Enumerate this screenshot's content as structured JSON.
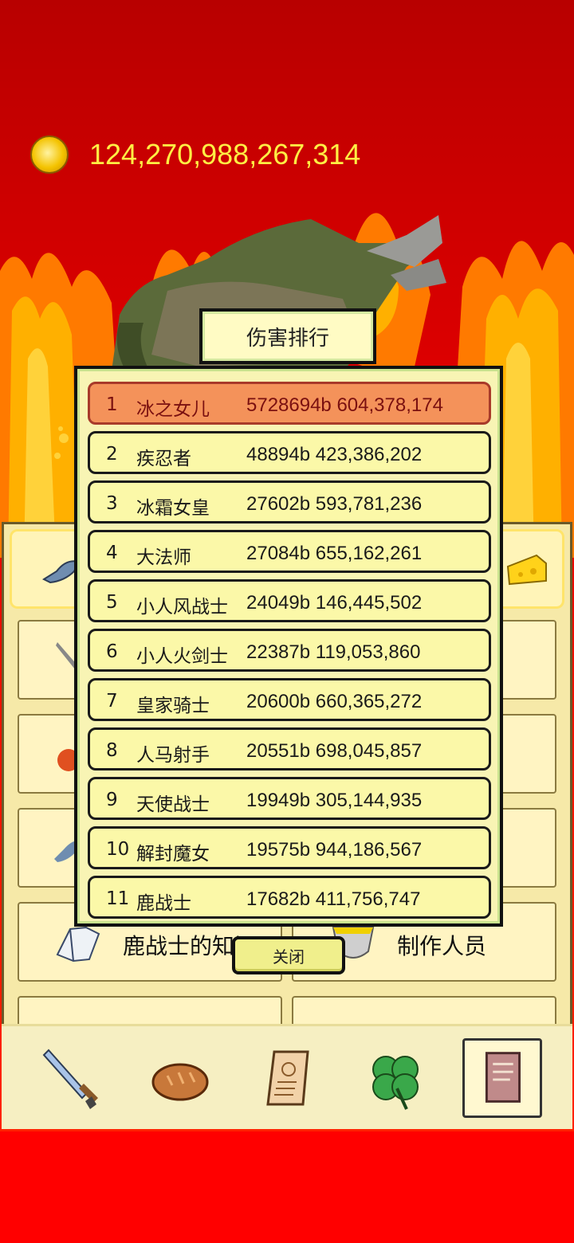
{
  "currency": {
    "icon": "gold-coin-icon",
    "amount": "124,270,988,267,314"
  },
  "ranking_dialog": {
    "title": "伤害排行",
    "close_label": "关闭",
    "rows": [
      {
        "rank": "1",
        "name": "冰之女儿",
        "score": "5728694b 604,378,174"
      },
      {
        "rank": "2",
        "name": "疾忍者",
        "score": "48894b 423,386,202"
      },
      {
        "rank": "3",
        "name": "冰霜女皇",
        "score": "27602b 593,781,236"
      },
      {
        "rank": "4",
        "name": "大法师",
        "score": "27084b 655,162,261"
      },
      {
        "rank": "5",
        "name": "小人风战士",
        "score": "24049b 146,445,502"
      },
      {
        "rank": "6",
        "name": "小人火剑士",
        "score": "22387b 119,053,860"
      },
      {
        "rank": "7",
        "name": "皇家骑士",
        "score": "20600b 660,365,272"
      },
      {
        "rank": "8",
        "name": "人马射手",
        "score": "20551b 698,045,857"
      },
      {
        "rank": "9",
        "name": "天使战士",
        "score": "19949b 305,144,935"
      },
      {
        "rank": "10",
        "name": "解封魔女",
        "score": "19575b 944,186,567"
      },
      {
        "rank": "11",
        "name": "鹿战士",
        "score": "17682b 411,756,747"
      }
    ]
  },
  "menu": {
    "items": [
      {
        "label": "鹿战士的知识",
        "icon": "open-book-icon"
      },
      {
        "label": "制作人员",
        "icon": "trophy-cup-icon"
      }
    ]
  },
  "bottom_nav": [
    {
      "icon": "sword-icon",
      "selected": false
    },
    {
      "icon": "bread-icon",
      "selected": false
    },
    {
      "icon": "scroll-icon",
      "selected": false
    },
    {
      "icon": "clover-icon",
      "selected": false
    },
    {
      "icon": "book-icon",
      "selected": true
    }
  ],
  "colors": {
    "background_red": "#e40000",
    "coin_text": "#ffef44",
    "first_place_row": "#f4925a",
    "row_fill": "#fbf8a8"
  }
}
